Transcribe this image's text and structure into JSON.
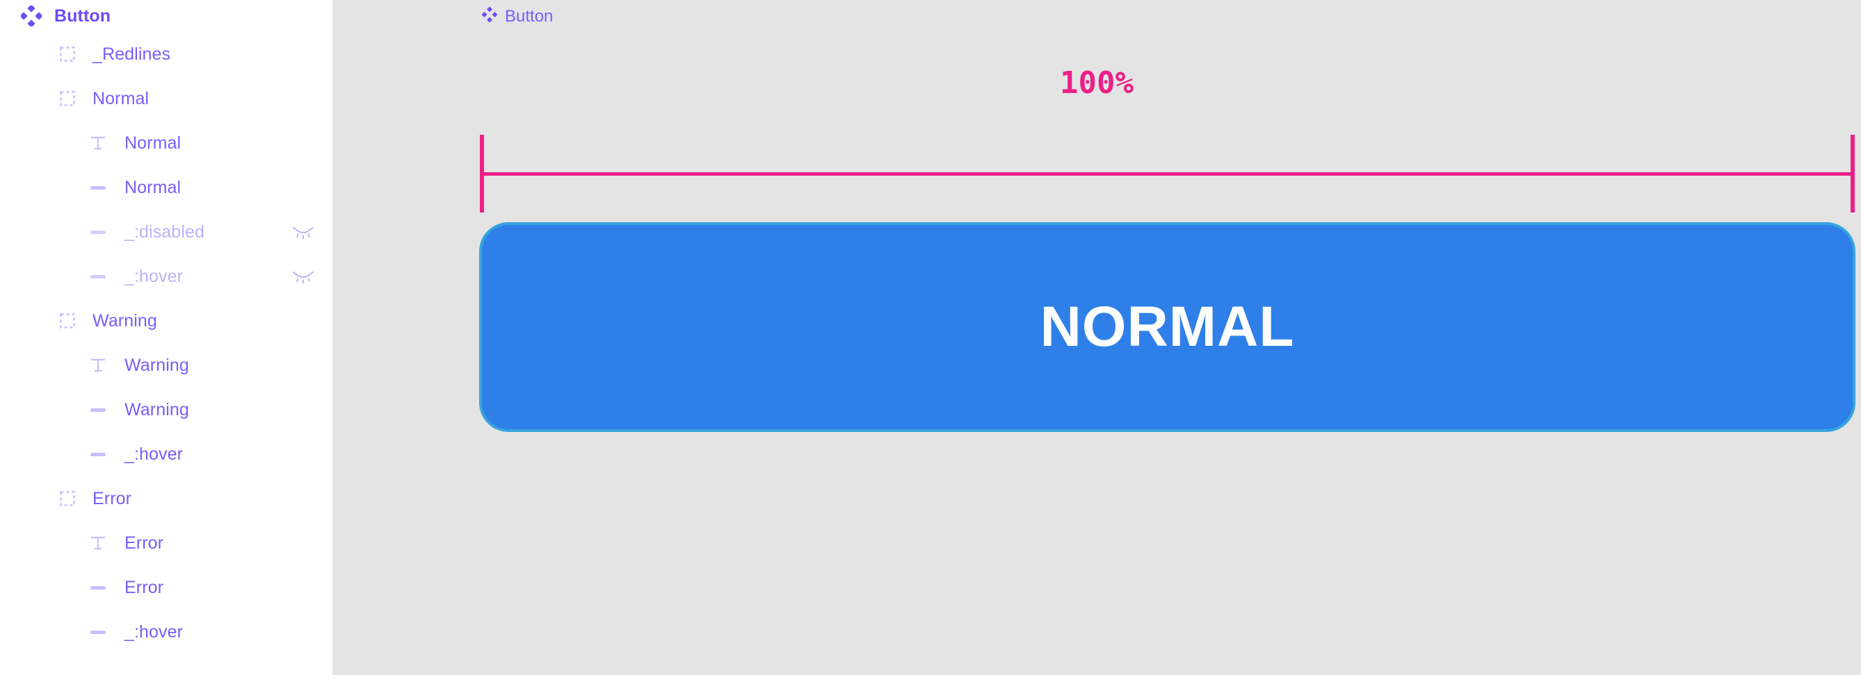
{
  "colors": {
    "sidebar_bg": "#FFFFFF",
    "canvas_bg": "#E4E4E4",
    "layer_purple": "#7B5CFA",
    "layer_purple_bold": "#6F4BF6",
    "layer_purple_dim": "#BEB0FB",
    "measure_pink": "#EC2188",
    "button_fill": "#2E80E8",
    "button_stroke": "#35A4DE",
    "button_text": "#FFFFFF"
  },
  "sidebar": {
    "root": {
      "label": "Button",
      "icon": "component-icon"
    },
    "items": [
      {
        "label": "_Redlines",
        "icon": "group-icon",
        "depth": 1,
        "dim": false,
        "hidden": false
      },
      {
        "label": "Normal",
        "icon": "group-icon",
        "depth": 1,
        "dim": false,
        "hidden": false
      },
      {
        "label": "Normal",
        "icon": "text-icon",
        "depth": 2,
        "dim": false,
        "hidden": false
      },
      {
        "label": "Normal",
        "icon": "rectangle-icon",
        "depth": 2,
        "dim": false,
        "hidden": false
      },
      {
        "label": "_:disabled",
        "icon": "rectangle-icon",
        "depth": 2,
        "dim": true,
        "hidden": true
      },
      {
        "label": "_:hover",
        "icon": "rectangle-icon",
        "depth": 2,
        "dim": true,
        "hidden": true
      },
      {
        "label": "Warning",
        "icon": "group-icon",
        "depth": 1,
        "dim": false,
        "hidden": false
      },
      {
        "label": "Warning",
        "icon": "text-icon",
        "depth": 2,
        "dim": false,
        "hidden": false
      },
      {
        "label": "Warning",
        "icon": "rectangle-icon",
        "depth": 2,
        "dim": false,
        "hidden": false
      },
      {
        "label": "_:hover",
        "icon": "rectangle-icon",
        "depth": 2,
        "dim": false,
        "hidden": false
      },
      {
        "label": "Error",
        "icon": "group-icon",
        "depth": 1,
        "dim": false,
        "hidden": false
      },
      {
        "label": "Error",
        "icon": "text-icon",
        "depth": 2,
        "dim": false,
        "hidden": false
      },
      {
        "label": "Error",
        "icon": "rectangle-icon",
        "depth": 2,
        "dim": false,
        "hidden": false
      },
      {
        "label": "_:hover",
        "icon": "rectangle-icon",
        "depth": 2,
        "dim": false,
        "hidden": false
      }
    ]
  },
  "canvas": {
    "breadcrumb": {
      "icon": "component-icon",
      "label": "Button"
    },
    "measurement": {
      "label": "100%",
      "left_tick": "measure-tick-left",
      "right_tick": "measure-tick-right"
    },
    "button": {
      "label": "NORMAL"
    }
  }
}
